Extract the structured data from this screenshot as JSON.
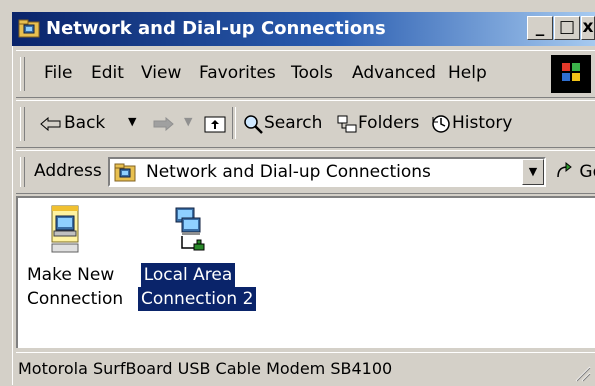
{
  "window": {
    "title": "Network and Dial-up Connections",
    "controls": {
      "minimize": "_",
      "maximize": "□",
      "close": "x"
    }
  },
  "menu": [
    "File",
    "Edit",
    "View",
    "Favorites",
    "Tools",
    "Advanced",
    "Help"
  ],
  "toolbar": {
    "back": "Back",
    "search": "Search",
    "folders": "Folders",
    "history": "History"
  },
  "address": {
    "label": "Address",
    "value": "Network and Dial-up Connections",
    "go": "Go"
  },
  "items": [
    {
      "line1": "Make New",
      "line2": "Connection",
      "icon": "make-new-connection-icon",
      "selected": false
    },
    {
      "line1": "Local Area",
      "line2": "Connection 2",
      "icon": "lan-connection-icon",
      "selected": true
    }
  ],
  "status": {
    "text": "Motorola SurfBoard USB Cable Modem SB4100"
  },
  "colors": {
    "titlebar": "#0a246a",
    "selection": "#0a246a",
    "face": "#d4d0c8"
  }
}
